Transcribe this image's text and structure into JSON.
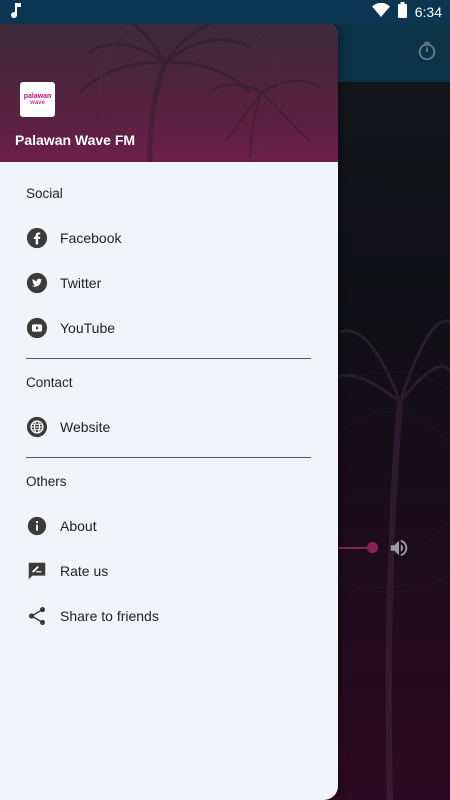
{
  "status_bar": {
    "time": "6:34",
    "icons": [
      "music-note-icon",
      "wifi-icon",
      "battery-icon"
    ]
  },
  "background_app": {
    "icons": [
      "timer-icon",
      "volume-icon"
    ],
    "accent_color": "#b23275",
    "toolbar_color": "#11435f"
  },
  "drawer": {
    "station_name": "Palawan Wave FM",
    "logo": {
      "line1": "palawan",
      "line2": "wave"
    },
    "sections": [
      {
        "title": "Social",
        "items": [
          {
            "label": "Facebook",
            "icon": "facebook-icon"
          },
          {
            "label": "Twitter",
            "icon": "twitter-icon"
          },
          {
            "label": "YouTube",
            "icon": "youtube-icon"
          }
        ]
      },
      {
        "title": "Contact",
        "items": [
          {
            "label": "Website",
            "icon": "globe-icon"
          }
        ]
      },
      {
        "title": "Others",
        "items": [
          {
            "label": "About",
            "icon": "info-icon"
          },
          {
            "label": "Rate us",
            "icon": "rate-icon"
          },
          {
            "label": "Share to friends",
            "icon": "share-icon"
          }
        ]
      }
    ]
  }
}
